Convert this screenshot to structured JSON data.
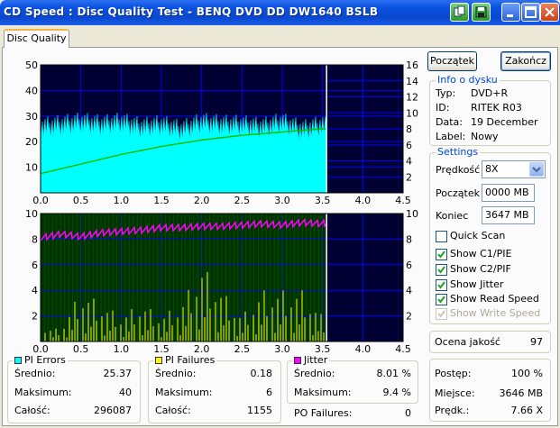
{
  "window": {
    "title": "CD Speed : Disc Quality Test - BENQ     DVD DD DW1640     BSLB"
  },
  "tabs": [
    {
      "label": "Disc Quality"
    }
  ],
  "buttons": {
    "start": "Początek",
    "finish": "Zakończ"
  },
  "info": {
    "title": "Info o dysku",
    "rows": [
      {
        "label": "Typ:",
        "value": "DVD+R"
      },
      {
        "label": "ID:",
        "value": "RITEK R03"
      },
      {
        "label": "Data:",
        "value": "19 December"
      },
      {
        "label": "Label:",
        "value": "Nowy"
      }
    ]
  },
  "settings": {
    "title": "Settings",
    "speed_label": "Prędkość",
    "speed_value": "8X",
    "start_label": "Początek",
    "start_value": "0000 MB",
    "end_label": "Koniec",
    "end_value": "3647 MB",
    "options": [
      {
        "label": "Quick Scan",
        "checked": false,
        "enabled": true
      },
      {
        "label": "Show C1/PIE",
        "checked": true,
        "enabled": true
      },
      {
        "label": "Show C2/PIF",
        "checked": true,
        "enabled": true
      },
      {
        "label": "Show Jitter",
        "checked": true,
        "enabled": true
      },
      {
        "label": "Show Read Speed",
        "checked": true,
        "enabled": true
      },
      {
        "label": "Show Write Speed",
        "checked": true,
        "enabled": false
      }
    ]
  },
  "quality": {
    "label": "Ocena jakość",
    "value": "97"
  },
  "progress": {
    "rows": [
      {
        "label": "Postęp:",
        "value": "100 %"
      },
      {
        "label": "Miejsce:",
        "value": "3646 MB"
      },
      {
        "label": "Prędk.:",
        "value": "7.66 X"
      }
    ]
  },
  "stats": {
    "pi_errors": {
      "title": "PI Errors",
      "color": "#00ffff",
      "avg_label": "Średnio:",
      "avg": "25.37",
      "max_label": "Maksimum:",
      "max": "40",
      "total_label": "Całość:",
      "total": "296087"
    },
    "pi_failures": {
      "title": "PI Failures",
      "color": "#ffff00",
      "avg_label": "Średnio:",
      "avg": "0.18",
      "max_label": "Maksimum:",
      "max": "6",
      "total_label": "Całość:",
      "total": "1155"
    },
    "jitter": {
      "title": "Jitter",
      "color": "#ff00ff",
      "avg_label": "Średnio:",
      "avg": "8.01 %",
      "max_label": "Maksimum:",
      "max": "9.4 %"
    },
    "po_failures": {
      "label": "PO Failures:",
      "value": "0"
    }
  },
  "colors": {
    "pie": "#00ffff",
    "pif": "#ffff00",
    "jitter": "#ff00ff",
    "speed": "#00c000",
    "plot_bg": "#000033",
    "plot2_bg": "#003300",
    "grid": "#0000ff",
    "marker": "#ffffff"
  },
  "chart_data": [
    {
      "type": "area",
      "title": "",
      "x": [
        0,
        0.25,
        0.5,
        0.75,
        1.0,
        1.25,
        1.5,
        1.75,
        2.0,
        2.25,
        2.5,
        2.75,
        3.0,
        3.25,
        3.5,
        3.55
      ],
      "series": [
        {
          "name": "PI Errors",
          "values": [
            25,
            26,
            27,
            26,
            27,
            25,
            26,
            24,
            27,
            26,
            26,
            25,
            27,
            24,
            26,
            25
          ]
        },
        {
          "name": "Read Speed",
          "axis": "right",
          "values": [
            2.4,
            3.0,
            3.6,
            4.2,
            4.8,
            5.3,
            5.8,
            6.2,
            6.6,
            6.9,
            7.2,
            7.4,
            7.6,
            7.8,
            8.0,
            8.0
          ]
        }
      ],
      "xlim": [
        0,
        4.5
      ],
      "ylim": [
        0,
        50
      ],
      "y2lim": [
        0,
        16
      ],
      "xticks": [
        "0.0",
        "0.5",
        "1.0",
        "1.5",
        "2.0",
        "2.5",
        "3.0",
        "3.5",
        "4.0",
        "4.5"
      ],
      "yticks": [
        "10",
        "20",
        "30",
        "40",
        "50"
      ],
      "y2ticks": [
        "2",
        "4",
        "6",
        "8",
        "10",
        "12",
        "14",
        "16"
      ],
      "marker_x": 3.55
    },
    {
      "type": "bar",
      "title": "",
      "x": [
        0,
        0.25,
        0.5,
        0.75,
        1.0,
        1.25,
        1.5,
        1.75,
        2.0,
        2.25,
        2.5,
        2.75,
        3.0,
        3.25,
        3.5,
        3.55
      ],
      "series": [
        {
          "name": "PI Failures",
          "values": [
            1,
            1,
            4,
            3,
            2,
            3,
            2,
            3,
            6,
            4,
            2,
            4,
            4,
            4,
            2,
            0
          ]
        },
        {
          "name": "Jitter",
          "axis": "right",
          "values": [
            8.1,
            8.4,
            8.2,
            8.5,
            8.6,
            8.7,
            8.9,
            8.9,
            9.0,
            9.0,
            9.1,
            9.2,
            9.1,
            9.3,
            9.2,
            9.3
          ]
        }
      ],
      "xlim": [
        0,
        4.5
      ],
      "ylim": [
        0,
        10
      ],
      "y2lim": [
        0,
        10
      ],
      "xticks": [
        "0.0",
        "0.5",
        "1.0",
        "1.5",
        "2.0",
        "2.5",
        "3.0",
        "3.5",
        "4.0",
        "4.5"
      ],
      "yticks": [
        "2",
        "4",
        "6",
        "8",
        "10"
      ],
      "y2ticks": [
        "2",
        "4",
        "6",
        "8",
        "10"
      ],
      "marker_x": 3.55
    }
  ]
}
